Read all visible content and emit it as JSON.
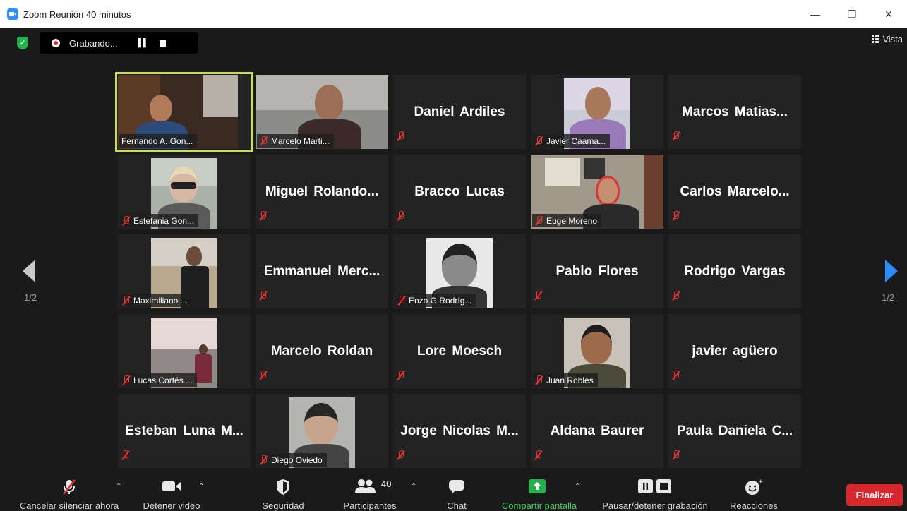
{
  "window": {
    "title": "Zoom Reunión 40 minutos",
    "controls": [
      "—",
      "❐",
      "✕"
    ]
  },
  "recording": {
    "status": "Grabando...",
    "pause_icon": "pause-icon",
    "stop_icon": "stop-icon"
  },
  "view_button": "Vista",
  "pagination": {
    "left": "1/2",
    "right": "1/2"
  },
  "participants": [
    {
      "name": "Fernando A. Gon...",
      "video": true,
      "active": true,
      "muted": false
    },
    {
      "name": "Marcelo Marti...",
      "video": true,
      "muted": true
    },
    {
      "name": "Daniel Ardiles",
      "video": false,
      "muted": true
    },
    {
      "name": "Javier Caama...",
      "video": true,
      "muted": true
    },
    {
      "name": "Marcos  Matias...",
      "video": false,
      "muted": true
    },
    {
      "name": "Estefania Gon...",
      "video": true,
      "muted": true
    },
    {
      "name": "Miguel  Rolando...",
      "video": false,
      "muted": true
    },
    {
      "name": "Bracco Lucas",
      "video": false,
      "muted": true
    },
    {
      "name": "Euge Moreno",
      "video": true,
      "muted": true
    },
    {
      "name": "Carlos  Marcelo...",
      "video": false,
      "muted": true
    },
    {
      "name": "Maximiliano ...",
      "video": true,
      "muted": true
    },
    {
      "name": "Emmanuel  Merc...",
      "video": false,
      "muted": true
    },
    {
      "name": "Enzo G Rodríg...",
      "video": true,
      "muted": true
    },
    {
      "name": "Pablo Flores",
      "video": false,
      "muted": true
    },
    {
      "name": "Rodrigo Vargas",
      "video": false,
      "muted": true
    },
    {
      "name": "Lucas Cortés ...",
      "video": true,
      "muted": true
    },
    {
      "name": "Marcelo Roldan",
      "video": false,
      "muted": true
    },
    {
      "name": "Lore Moesch",
      "video": false,
      "muted": true
    },
    {
      "name": "Juan Robles",
      "video": true,
      "muted": true
    },
    {
      "name": "javier agüero",
      "video": false,
      "muted": true
    },
    {
      "name": "Esteban  Luna  M...",
      "video": false,
      "muted": true
    },
    {
      "name": "Diego Oviedo",
      "video": true,
      "muted": true
    },
    {
      "name": "Jorge  Nicolas  M...",
      "video": false,
      "muted": true
    },
    {
      "name": "Aldana Baurer",
      "video": false,
      "muted": true
    },
    {
      "name": "Paula  Daniela  C...",
      "video": false,
      "muted": true
    }
  ],
  "toolbar": {
    "mute": "Cancelar silenciar ahora",
    "video": "Detener video",
    "security": "Seguridad",
    "participants": "Participantes",
    "participants_count": "40",
    "chat": "Chat",
    "share": "Compartir pantalla",
    "record": "Pausar/detener grabación",
    "reactions": "Reacciones",
    "end": "Finalizar"
  },
  "colors": {
    "accent": "#2D8CFF",
    "active_speaker": "#c7e25a",
    "share_green": "#22b14c",
    "end_red": "#d7262c",
    "muted_red": "#e33333"
  }
}
